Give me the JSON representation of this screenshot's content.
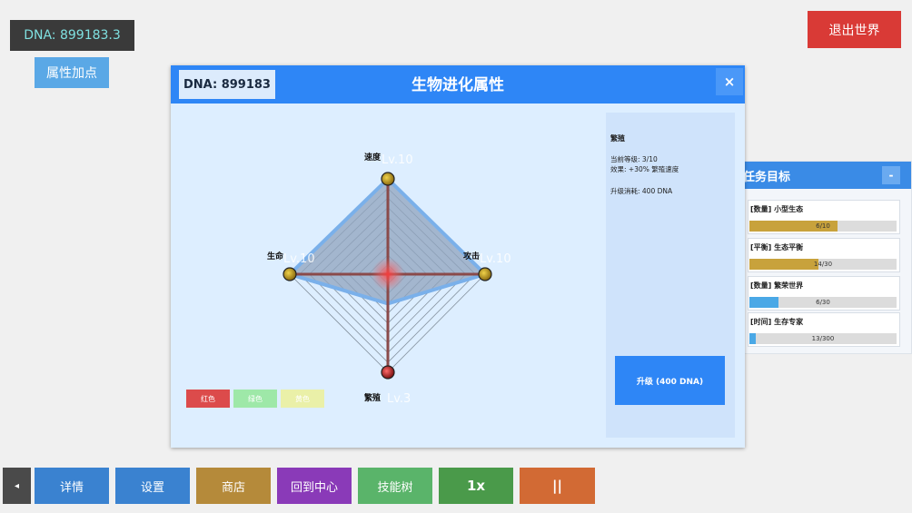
{
  "top": {
    "dna_label": "DNA: 899183.3",
    "attr_button": "属性加点",
    "exit_button": "退出世界"
  },
  "modal": {
    "dna_label": "DNA: 899183",
    "title": "生物进化属性",
    "close": "×",
    "attributes": [
      {
        "name": "速度",
        "level_label": "Lv.10",
        "level": 10,
        "max": 10
      },
      {
        "name": "攻击",
        "level_label": "Lv.10",
        "level": 10,
        "max": 10
      },
      {
        "name": "繁殖",
        "level_label": "Lv.3",
        "level": 3,
        "max": 10
      },
      {
        "name": "生命",
        "level_label": "Lv.10",
        "level": 10,
        "max": 10
      }
    ],
    "info": {
      "name": "繁殖",
      "current_level": "当前等级: 3/10",
      "effect": "效果: +30% 繁殖速度",
      "cost": "升级消耗: 400 DNA"
    },
    "upgrade_button": "升级 (400 DNA)",
    "legend": [
      {
        "label": "红色",
        "color": "#dc4b4b"
      },
      {
        "label": "绿色",
        "color": "#9ee8a8"
      },
      {
        "label": "黄色",
        "color": "#eaf0a8"
      }
    ]
  },
  "tasks": {
    "title": "任务目标",
    "collapse": "-",
    "items": [
      {
        "name": "[数量] 小型生态",
        "count": "6/10",
        "progress": 0.6,
        "color": "#c8a23c"
      },
      {
        "name": "[平衡] 生态平衡",
        "count": "14/30",
        "progress": 0.467,
        "color": "#c8a23c"
      },
      {
        "name": "[数量] 繁荣世界",
        "count": "6/30",
        "progress": 0.2,
        "color": "#4aa8e6"
      },
      {
        "name": "[时间] 生存专家",
        "count": "13/300",
        "progress": 0.043,
        "color": "#4aa8e6"
      }
    ]
  },
  "toolbar": {
    "collapse": "◂",
    "details": "详情",
    "settings": "设置",
    "shop": "商店",
    "center": "回到中心",
    "skills": "技能树",
    "speed": "1x",
    "pause": "||"
  },
  "colors": {
    "accent": "#2e86f6",
    "exit": "#d93a36"
  }
}
